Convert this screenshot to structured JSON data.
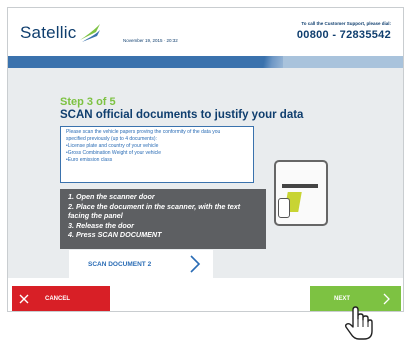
{
  "header": {
    "logo_text": "Satellic",
    "datetime": "November 19, 2015 · 20:32",
    "support_label": "To call the Customer Support, please dial:",
    "support_number": "00800 - 72835542"
  },
  "step": {
    "label": "Step 3 of 5",
    "title": "SCAN official documents to justify your data"
  },
  "info_box": {
    "lines": [
      "Please scan the vehicle papers proving the conformity of the data you",
      "specified previously (up to 4 documents):",
      "•License plate and country of your vehicle",
      "•Gross Combination Weight of your vehicle",
      "•Euro emission class"
    ]
  },
  "instructions": {
    "items": [
      "1. Open the scanner door",
      "2. Place the document in the scanner, with the text",
      "facing the panel",
      "3. Release the door",
      "4. Press SCAN DOCUMENT"
    ]
  },
  "scan_button": {
    "label": "SCAN DOCUMENT 2"
  },
  "footer": {
    "cancel_label": "CANCEL",
    "next_label": "NEXT"
  },
  "colors": {
    "brand_blue": "#0f3e6e",
    "accent_blue": "#2a6cb5",
    "green": "#7dc242",
    "red": "#d81f26"
  },
  "icons": {
    "logo": "satellic-logo-icon",
    "scan_chevron": "chevron-right-icon",
    "cancel": "close-icon",
    "next": "chevron-right-icon",
    "pointer": "hand-pointer-icon",
    "illustration": "scanner-illustration"
  }
}
